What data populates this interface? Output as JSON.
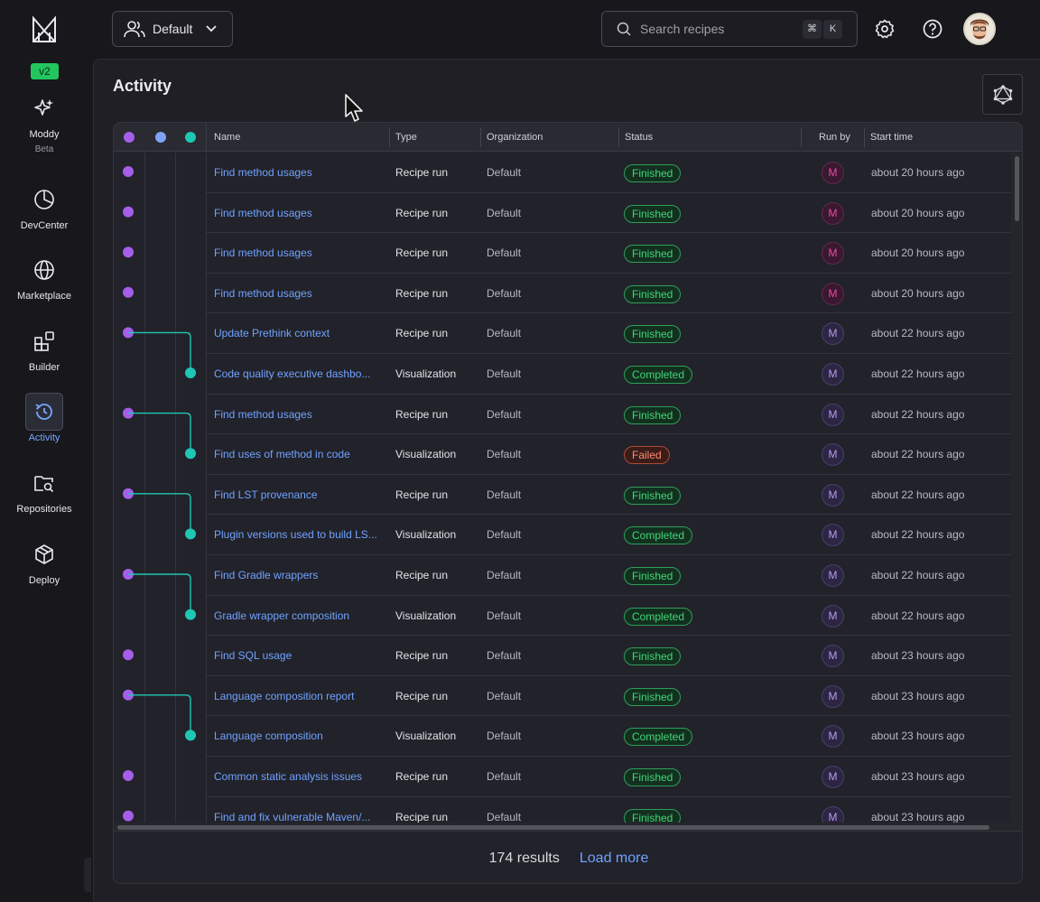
{
  "brand": {
    "version": "v2"
  },
  "sidebar": {
    "items": [
      {
        "id": "moddy",
        "label": "Moddy",
        "sub": "Beta",
        "icon": "sparkles-icon"
      },
      {
        "id": "devcenter",
        "label": "DevCenter",
        "icon": "pie-chart-icon"
      },
      {
        "id": "marketplace",
        "label": "Marketplace",
        "icon": "globe-icon"
      },
      {
        "id": "builder",
        "label": "Builder",
        "icon": "blocks-icon"
      },
      {
        "id": "activity",
        "label": "Activity",
        "icon": "history-icon",
        "active": true
      },
      {
        "id": "repositories",
        "label": "Repositories",
        "icon": "folder-search-icon"
      },
      {
        "id": "deploy",
        "label": "Deploy",
        "icon": "package-icon"
      }
    ]
  },
  "header": {
    "org_label": "Default",
    "search_placeholder": "Search recipes",
    "shortcut_mod": "⌘",
    "shortcut_key": "K"
  },
  "page": {
    "title": "Activity"
  },
  "table": {
    "columns": {
      "name": "Name",
      "type": "Type",
      "organization": "Organization",
      "status": "Status",
      "run_by": "Run by",
      "start_time": "Start time"
    },
    "rows": [
      {
        "name": "Find method usages",
        "type": "Recipe run",
        "org": "Default",
        "status": "Finished",
        "run_by": "M",
        "start": "about 20 hours ago"
      },
      {
        "name": "Find method usages",
        "type": "Recipe run",
        "org": "Default",
        "status": "Finished",
        "run_by": "M",
        "start": "about 20 hours ago"
      },
      {
        "name": "Find method usages",
        "type": "Recipe run",
        "org": "Default",
        "status": "Finished",
        "run_by": "M",
        "start": "about 20 hours ago"
      },
      {
        "name": "Find method usages",
        "type": "Recipe run",
        "org": "Default",
        "status": "Finished",
        "run_by": "M",
        "start": "about 20 hours ago"
      },
      {
        "name": "Update Prethink context",
        "type": "Recipe run",
        "org": "Default",
        "status": "Finished",
        "run_by": "M",
        "start": "about 22 hours ago"
      },
      {
        "name": "Code quality executive dashbo...",
        "type": "Visualization",
        "org": "Default",
        "status": "Completed",
        "run_by": "M",
        "start": "about 22 hours ago"
      },
      {
        "name": "Find method usages",
        "type": "Recipe run",
        "org": "Default",
        "status": "Finished",
        "run_by": "M",
        "start": "about 22 hours ago"
      },
      {
        "name": "Find uses of method in code",
        "type": "Visualization",
        "org": "Default",
        "status": "Failed",
        "run_by": "M",
        "start": "about 22 hours ago"
      },
      {
        "name": "Find LST provenance",
        "type": "Recipe run",
        "org": "Default",
        "status": "Finished",
        "run_by": "M",
        "start": "about 22 hours ago"
      },
      {
        "name": "Plugin versions used to build LS...",
        "type": "Visualization",
        "org": "Default",
        "status": "Completed",
        "run_by": "M",
        "start": "about 22 hours ago"
      },
      {
        "name": "Find Gradle wrappers",
        "type": "Recipe run",
        "org": "Default",
        "status": "Finished",
        "run_by": "M",
        "start": "about 22 hours ago"
      },
      {
        "name": "Gradle wrapper composition",
        "type": "Visualization",
        "org": "Default",
        "status": "Completed",
        "run_by": "M",
        "start": "about 22 hours ago"
      },
      {
        "name": "Find SQL usage",
        "type": "Recipe run",
        "org": "Default",
        "status": "Finished",
        "run_by": "M",
        "start": "about 23 hours ago"
      },
      {
        "name": "Language composition report",
        "type": "Recipe run",
        "org": "Default",
        "status": "Finished",
        "run_by": "M",
        "start": "about 23 hours ago"
      },
      {
        "name": "Language composition",
        "type": "Visualization",
        "org": "Default",
        "status": "Completed",
        "run_by": "M",
        "start": "about 23 hours ago"
      },
      {
        "name": "Common static analysis issues",
        "type": "Recipe run",
        "org": "Default",
        "status": "Finished",
        "run_by": "M",
        "start": "about 23 hours ago"
      },
      {
        "name": "Find and fix vulnerable Maven/...",
        "type": "Recipe run",
        "org": "Default",
        "status": "Finished",
        "run_by": "M",
        "start": "about 23 hours ago"
      }
    ]
  },
  "footer": {
    "count": "174 results",
    "load_more": "Load more"
  },
  "colors": {
    "accent_blue": "#6fa3ff",
    "lane_purple": "#a45ee8",
    "lane_blue": "#7fa2f4",
    "lane_teal": "#1fc6b4",
    "status_ok": "#41d677",
    "status_fail": "#ff8a70"
  }
}
